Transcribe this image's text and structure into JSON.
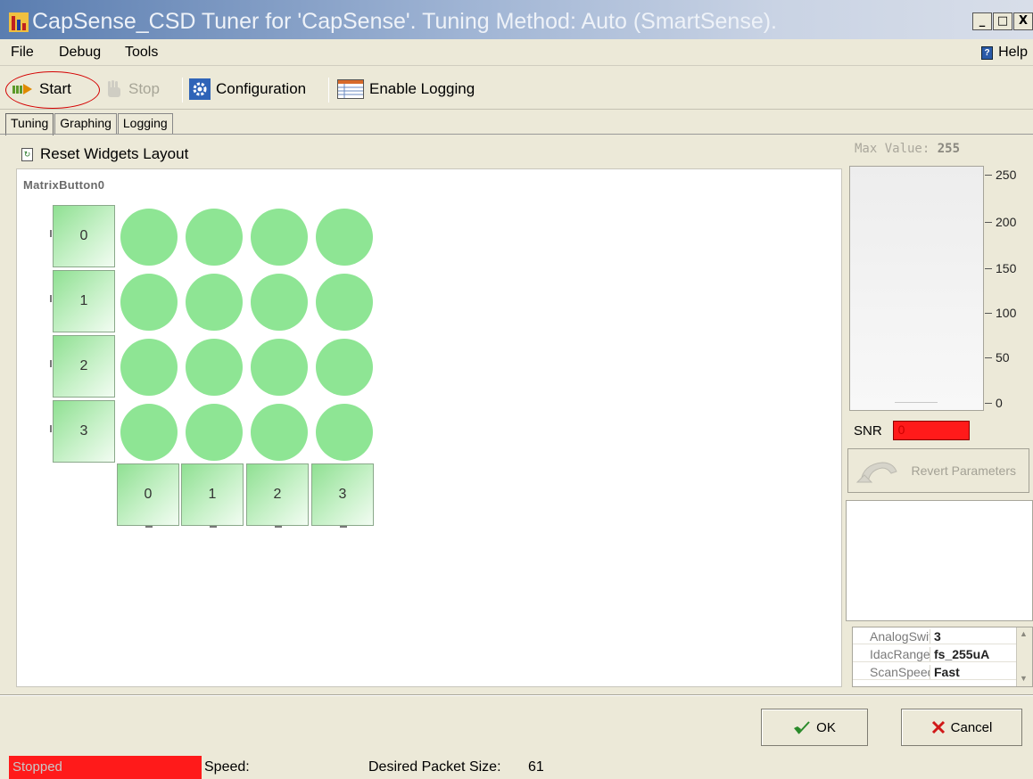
{
  "window": {
    "title": "CapSense_CSD Tuner for 'CapSense'. Tuning Method: Auto (SmartSense).",
    "controls": [
      "_",
      "□",
      "X"
    ]
  },
  "menubar": {
    "items": [
      "File",
      "Debug",
      "Tools"
    ],
    "help_label": "Help",
    "help_icon": "help-book-icon"
  },
  "toolbar": {
    "start_label": "Start",
    "stop_label": "Stop",
    "configuration_label": "Configuration",
    "logging_label": "Enable Logging"
  },
  "tabs": [
    "Tuning",
    "Graphing",
    "Logging"
  ],
  "active_tab": "Tuning",
  "main": {
    "reset_label": "Reset Widgets Layout",
    "widget_title": "MatrixButton0",
    "row_labels": [
      "0",
      "1",
      "2",
      "3"
    ],
    "col_labels": [
      "0",
      "1",
      "2",
      "3"
    ],
    "circle_color": "#8ee594"
  },
  "side": {
    "max_value_label": "Max Value:",
    "max_value": "255",
    "current_level": 0,
    "scale_ticks": [
      "250",
      "200",
      "150",
      "100",
      "50",
      "0"
    ],
    "snr_label": "SNR",
    "snr_value": "0",
    "revert_label": "Revert Parameters",
    "properties": [
      {
        "name": "AnalogSwitchDivider",
        "value": "3"
      },
      {
        "name": "IdacRange",
        "value": "fs_255uA"
      },
      {
        "name": "ScanSpeed",
        "value": "Fast"
      }
    ]
  },
  "dialog": {
    "ok_label": "OK",
    "cancel_label": "Cancel"
  },
  "status": {
    "state": "Stopped",
    "speed_label": "Speed:",
    "packet_label": "Desired Packet Size:",
    "packet_size": "61"
  },
  "colors": {
    "status_stopped": "#ff1a1a",
    "highlight_oval": "#d40000",
    "button_green": "#8fe092"
  }
}
